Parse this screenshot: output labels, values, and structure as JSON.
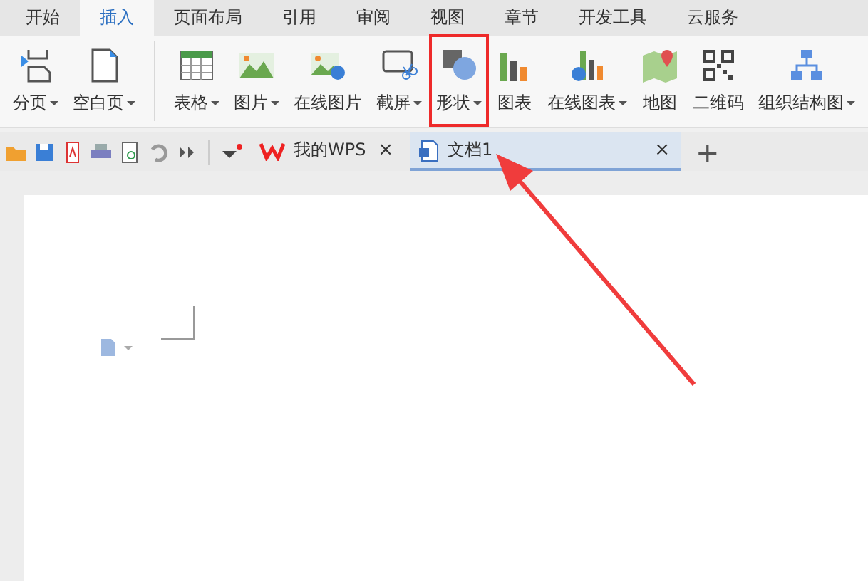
{
  "menu_tabs": [
    {
      "label": "开始",
      "selected": false
    },
    {
      "label": "插入",
      "selected": true
    },
    {
      "label": "页面布局",
      "selected": false
    },
    {
      "label": "引用",
      "selected": false
    },
    {
      "label": "审阅",
      "selected": false
    },
    {
      "label": "视图",
      "selected": false
    },
    {
      "label": "章节",
      "selected": false
    },
    {
      "label": "开发工具",
      "selected": false
    },
    {
      "label": "云服务",
      "selected": false
    }
  ],
  "ribbon_groups": [
    [
      {
        "label": "分页",
        "dropdown": true,
        "highlighted": false
      },
      {
        "label": "空白页",
        "dropdown": true,
        "highlighted": false
      }
    ],
    [
      {
        "label": "表格",
        "dropdown": true,
        "highlighted": false
      },
      {
        "label": "图片",
        "dropdown": true,
        "highlighted": false
      },
      {
        "label": "在线图片",
        "dropdown": false,
        "highlighted": false
      },
      {
        "label": "截屏",
        "dropdown": true,
        "highlighted": false
      },
      {
        "label": "形状",
        "dropdown": true,
        "highlighted": true
      },
      {
        "label": "图表",
        "dropdown": false,
        "highlighted": false
      },
      {
        "label": "在线图表",
        "dropdown": true,
        "highlighted": false
      },
      {
        "label": "地图",
        "dropdown": false,
        "highlighted": false
      },
      {
        "label": "二维码",
        "dropdown": false,
        "highlighted": false
      },
      {
        "label": "组织结构图",
        "dropdown": true,
        "highlighted": false
      }
    ]
  ],
  "doc_tabs": [
    {
      "label": "我的WPS",
      "close": "×",
      "selected": false
    },
    {
      "label": "文档1",
      "close": "×",
      "selected": true
    }
  ],
  "new_tab": "+"
}
